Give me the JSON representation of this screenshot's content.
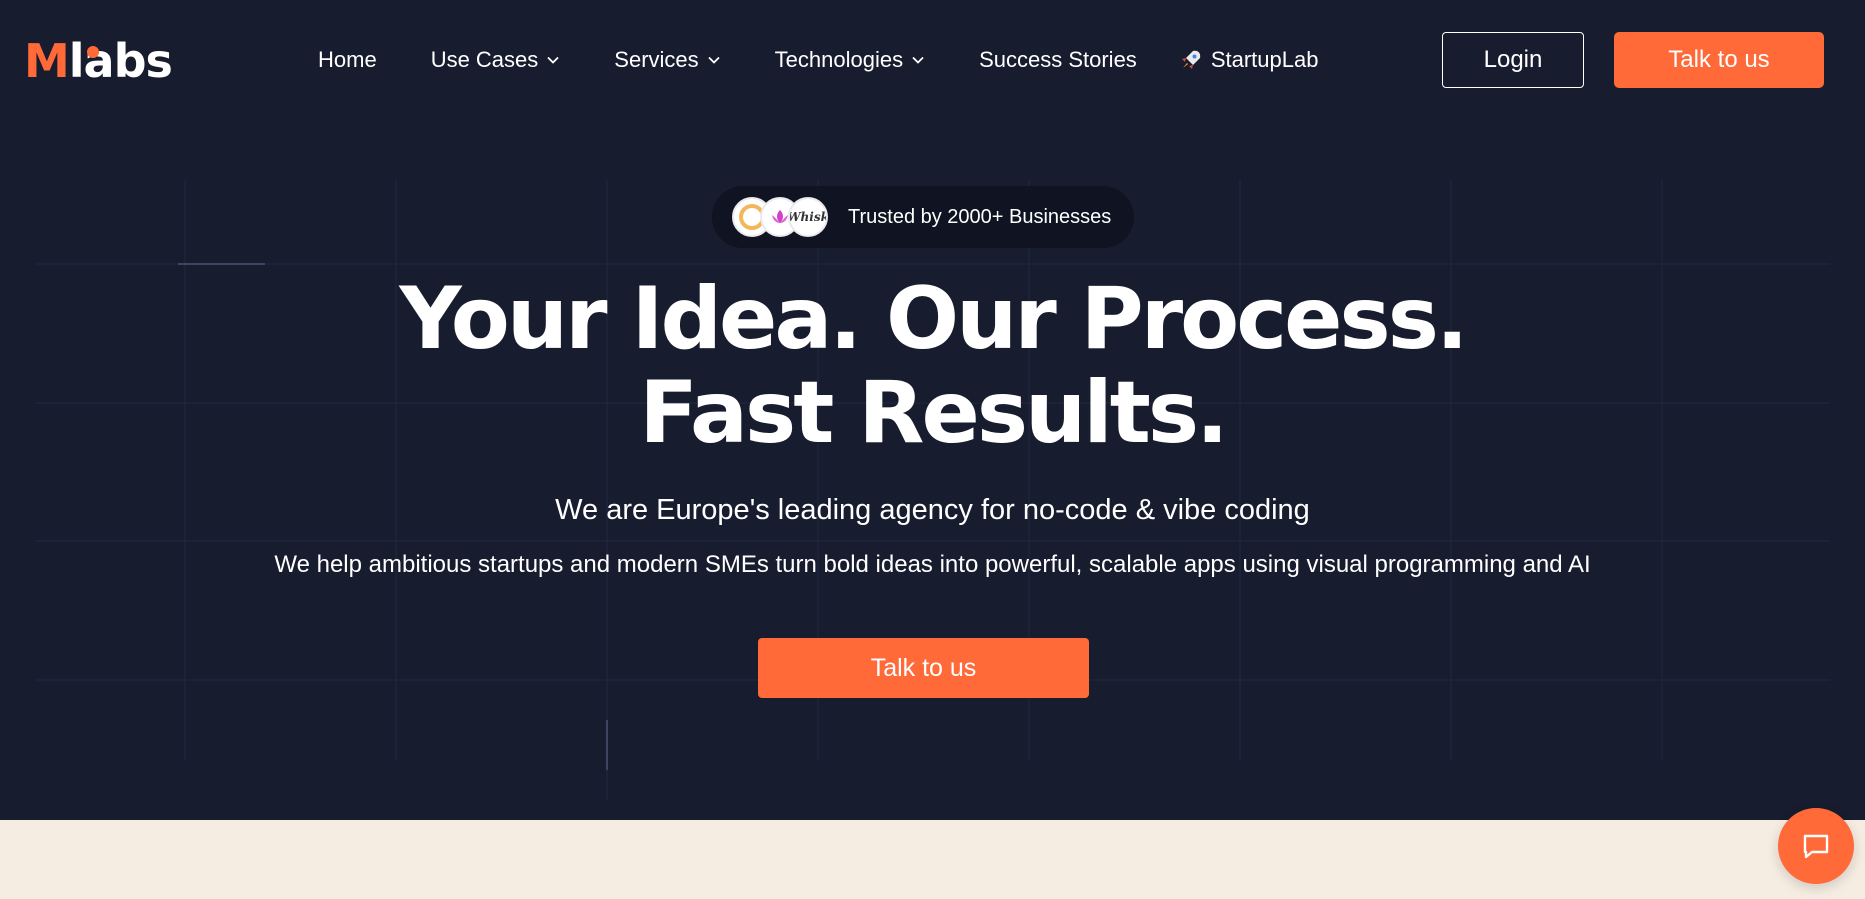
{
  "brand": {
    "logo_m": "M",
    "logo_rest": "labs",
    "accent": "#ff6a38",
    "background": "#171c2e",
    "section_bg": "#f5ece2"
  },
  "nav": {
    "items": [
      {
        "label": "Home",
        "has_dropdown": false
      },
      {
        "label": "Use Cases",
        "has_dropdown": true
      },
      {
        "label": "Services",
        "has_dropdown": true
      },
      {
        "label": "Technologies",
        "has_dropdown": true
      },
      {
        "label": "Success Stories",
        "has_dropdown": false
      },
      {
        "label": "StartupLab",
        "has_dropdown": false,
        "icon": "rocket-icon"
      }
    ],
    "login_label": "Login",
    "cta_label": "Talk to us"
  },
  "hero": {
    "badge_text": "Trusted by 2000+ Businesses",
    "badge_logo_text": "Whisk",
    "headline_line1": "Your Idea. Our Process.",
    "headline_line2": "Fast Results.",
    "subtitle": "We are Europe's leading agency for no-code & vibe coding",
    "description": "We help ambitious startups and modern SMEs turn bold ideas into powerful, scalable apps using visual programming and AI",
    "cta_label": "Talk to us"
  },
  "chat_widget": {
    "icon": "chat-icon"
  }
}
